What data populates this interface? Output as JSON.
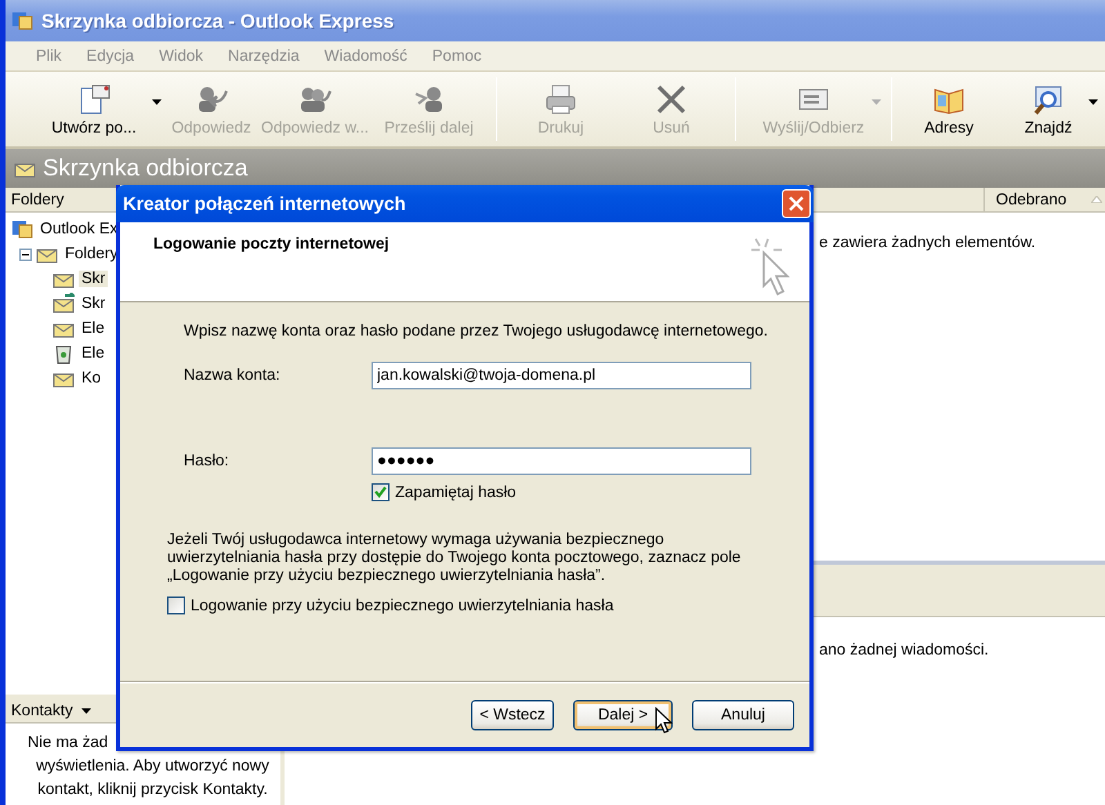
{
  "window": {
    "title": "Skrzynka odbiorcza - Outlook Express"
  },
  "menu": [
    "Plik",
    "Edycja",
    "Widok",
    "Narzędzia",
    "Wiadomość",
    "Pomoc"
  ],
  "toolbar": [
    {
      "label": "Utwórz po...",
      "disabled": false,
      "dropdown": true,
      "separator_before": false
    },
    {
      "label": "Odpowiedz",
      "disabled": true,
      "dropdown": false,
      "separator_before": false
    },
    {
      "label": "Odpowiedz w...",
      "disabled": true,
      "dropdown": false,
      "separator_before": false
    },
    {
      "label": "Prześlij dalej",
      "disabled": true,
      "dropdown": false,
      "separator_before": false
    },
    {
      "label": "Drukuj",
      "disabled": true,
      "dropdown": false,
      "separator_before": true
    },
    {
      "label": "Usuń",
      "disabled": true,
      "dropdown": false,
      "separator_before": false
    },
    {
      "label": "Wyślij/Odbierz",
      "disabled": true,
      "dropdown": true,
      "separator_before": true
    },
    {
      "label": "Adresy",
      "disabled": false,
      "dropdown": false,
      "separator_before": true
    },
    {
      "label": "Znajdź",
      "disabled": false,
      "dropdown": true,
      "separator_before": false
    }
  ],
  "folder_header": "Skrzynka odbiorcza",
  "folders_pane": {
    "title": "Foldery",
    "tree": [
      {
        "label": "Outlook Ex",
        "selected": false,
        "children": [
          {
            "label": "Foldery",
            "selected": false,
            "expanded": true,
            "children": [
              {
                "label": "Skr",
                "selected": true
              },
              {
                "label": "Skr",
                "selected": false
              },
              {
                "label": "Ele",
                "selected": false
              },
              {
                "label": "Ele",
                "selected": false
              },
              {
                "label": "Ko",
                "selected": false
              }
            ]
          }
        ]
      }
    ]
  },
  "contacts_pane": {
    "title": "Kontakty",
    "lines": [
      "Nie ma żad",
      "wyświetlenia. Aby utworzyć nowy",
      "kontakt, kliknij przycisk Kontakty."
    ]
  },
  "message_list": {
    "column": "Odebrano",
    "empty_text": "e zawiera żadnych elementów."
  },
  "preview": {
    "empty_text": "ano żadnej wiadomości."
  },
  "dialog": {
    "title": "Kreator połączeń internetowych",
    "heading": "Logowanie poczty internetowej",
    "intro": "Wpisz nazwę konta oraz hasło podane przez Twojego usługodawcę internetowego.",
    "fields": [
      {
        "label": "Nazwa konta:",
        "value": "jan.kowalski@twoja-domena.pl"
      },
      {
        "label": "Hasło:",
        "value": "●●●●●●"
      }
    ],
    "remember": {
      "label": "Zapamiętaj hasło",
      "checked": true
    },
    "note": "Jeżeli Twój usługodawca internetowy wymaga używania bezpiecznego uwierzytelniania hasła przy dostępie do Twojego konta pocztowego, zaznacz pole „Logowanie przy użyciu bezpiecznego uwierzytelniania hasła”.",
    "spa": {
      "label": "Logowanie przy użyciu bezpiecznego uwierzytelniania hasła",
      "checked": false
    },
    "buttons": [
      {
        "label": "< Wstecz",
        "default": false
      },
      {
        "label": "Dalej >",
        "default": true
      },
      {
        "label": "Anuluj",
        "default": false
      }
    ]
  }
}
